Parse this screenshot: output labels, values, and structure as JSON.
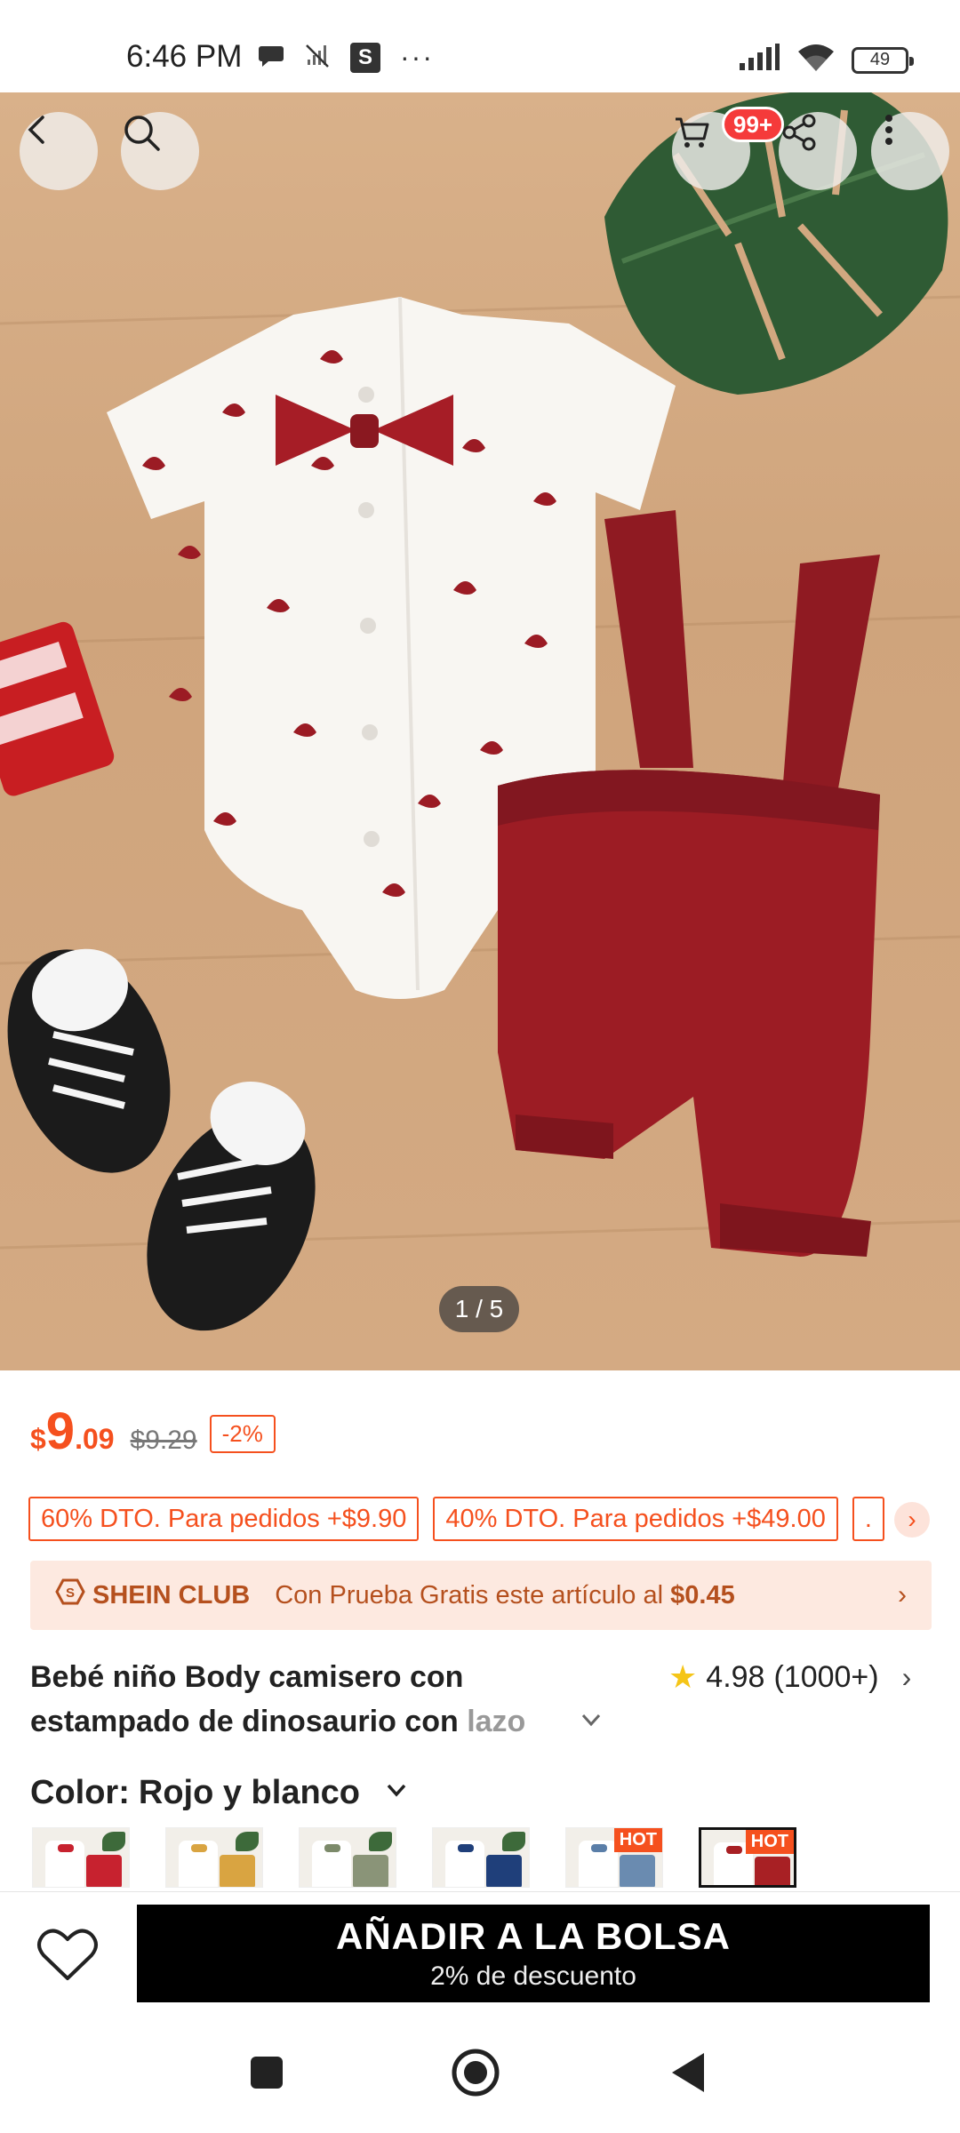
{
  "status_bar": {
    "time": "6:46 PM",
    "battery": "49",
    "icons": [
      "chat-bubble-icon",
      "no-sim-signal-icon",
      "s-app-icon",
      "more-dots-icon",
      "cell-signal-icon",
      "wifi-icon",
      "battery-icon"
    ],
    "s_label": "S",
    "dots": "···"
  },
  "hero": {
    "cart_badge": "99+",
    "pager": "1 / 5",
    "icons": [
      "back-arrow-icon",
      "search-icon",
      "cart-icon",
      "share-icon",
      "more-vertical-icon"
    ]
  },
  "price": {
    "currency": "$",
    "integer": "9",
    "decimal": ".09",
    "original": "$9.29",
    "discount": "-2%"
  },
  "coupons": [
    "60% DTO. Para pedidos +$9.90",
    "40% DTO. Para pedidos +$49.00",
    "."
  ],
  "club": {
    "name": "SHEIN CLUB",
    "text": "Con Prueba Gratis este artículo al",
    "price": "$0.45"
  },
  "product": {
    "title_main": "Bebé niño Body camisero con estampado de dinosaurio con",
    "title_fade": "lazo",
    "rating": "4.98",
    "reviews": "(1000+)"
  },
  "color": {
    "label": "Color:",
    "value": "Rojo y blanco",
    "hot_label": "HOT",
    "swatches": [
      {
        "bow": "#c7222f",
        "short": "#c7222f"
      },
      {
        "bow": "#d9a441",
        "short": "#d9a441"
      },
      {
        "bow": "#7c8a6a",
        "short": "#8a9478"
      },
      {
        "bow": "#1f3f7a",
        "short": "#1f3f7a"
      },
      {
        "bow": "#5a7ea8",
        "short": "#6a8bb0"
      },
      {
        "bow": "#a82024",
        "short": "#a82024"
      }
    ]
  },
  "bottom": {
    "add_label": "AÑADIR A LA BOLSA",
    "add_sub": "2% de descuento"
  },
  "colors": {
    "accent": "#f5501e",
    "club_text": "#b5501e",
    "club_bg": "#fde9e0",
    "primary_button": "#000000"
  }
}
